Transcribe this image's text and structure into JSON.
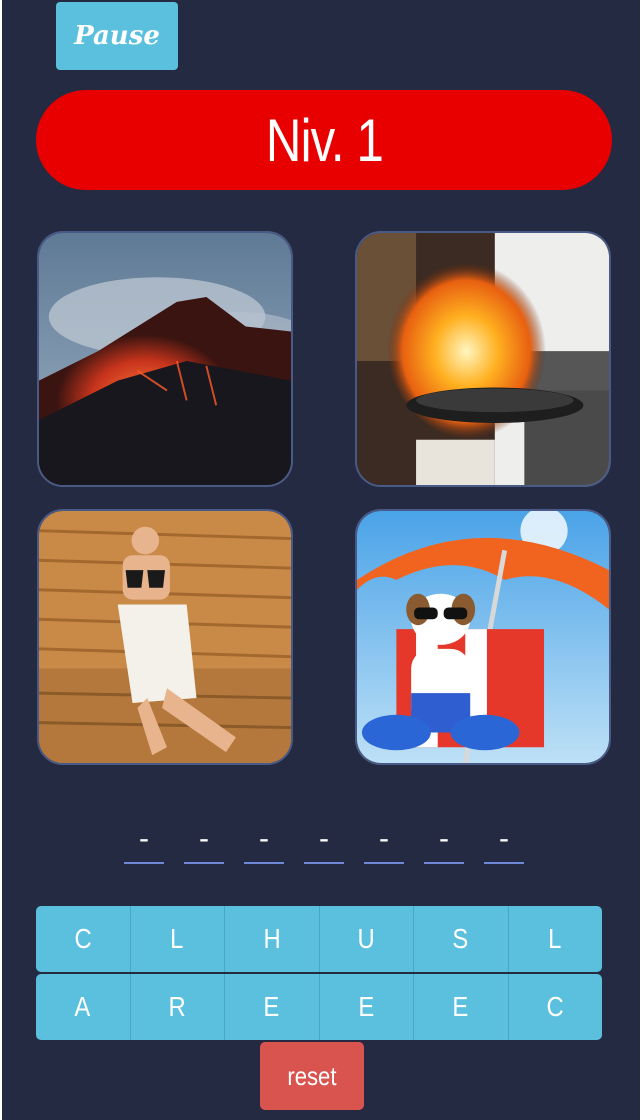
{
  "controls": {
    "pause_label": "Pause",
    "reset_label": "reset"
  },
  "level": {
    "label": "Niv. 1"
  },
  "images": [
    {
      "name": "volcano-eruption-image",
      "subject": "volcano"
    },
    {
      "name": "flambe-pan-image",
      "subject": "flaming pan"
    },
    {
      "name": "sauna-image",
      "subject": "sauna"
    },
    {
      "name": "dog-beach-umbrella-image",
      "subject": "dog under umbrella"
    }
  ],
  "answer_slots": [
    "-",
    "-",
    "-",
    "-",
    "-",
    "-",
    "-"
  ],
  "letters": {
    "row1": [
      "C",
      "L",
      "H",
      "U",
      "S",
      "L"
    ],
    "row2": [
      "A",
      "R",
      "E",
      "E",
      "E",
      "C"
    ]
  },
  "colors": {
    "background": "#242a42",
    "level_banner": "#e80000",
    "key": "#5bc0de",
    "reset": "#d9534f",
    "slot_underline": "#6f86d6"
  }
}
